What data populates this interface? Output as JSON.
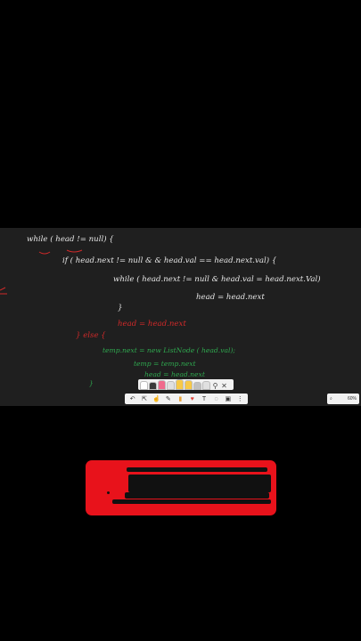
{
  "board": {
    "lines": [
      "while ( head != null) {",
      "if ( head.next != null   & & head.val == head.next.val) {",
      "while ( head.next != null  &  head.val = head.next.Val)",
      "head = head.next",
      "}",
      "head = head.next",
      "} else {",
      "temp.next = new ListNode ( head.val);",
      "temp = temp.next",
      "head = head.next",
      "}"
    ]
  },
  "pens": {
    "colors": [
      "#ffffff",
      "#3a3a3a",
      "#f06a8c",
      "#e0e0e0",
      "#f7c948",
      "#f7c948",
      "#c0c0c0",
      "#e0e0e0"
    ]
  },
  "pen_tray": {
    "icons": [
      "search-icon",
      "close-icon"
    ],
    "search_glyph": "⚲",
    "close_glyph": "✕"
  },
  "toolbar": {
    "icons": [
      "undo-icon",
      "select-icon",
      "touch-icon",
      "pen-icon",
      "highlighter-icon",
      "eraser-icon",
      "text-icon",
      "shapes-icon",
      "image-icon",
      "more-icon"
    ],
    "glyphs": [
      "↶",
      "⇱",
      "☝",
      "✎",
      "▮",
      "♥",
      "T",
      "◌",
      "▣",
      "⋮"
    ]
  },
  "zoom": {
    "icon": "zoom-icon",
    "glyph": "🔍",
    "value": "60%"
  },
  "colors": {
    "board": "#1f1f1f",
    "card": "#e8121b",
    "ink_white": "#e8e8e8",
    "ink_red": "#d22a2a",
    "ink_green": "#2fa84f"
  }
}
